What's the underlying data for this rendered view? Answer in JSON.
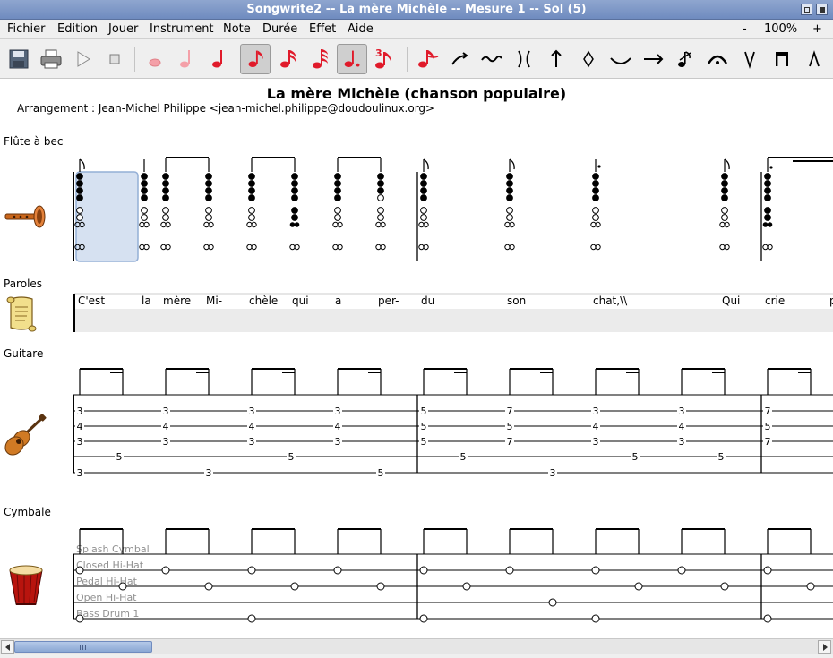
{
  "window": {
    "title": "Songwrite2 -- La mère Michèle -- Mesure 1 -- Sol (5)"
  },
  "menu": [
    "Fichier",
    "Edition",
    "Jouer",
    "Instrument",
    "Note",
    "Durée",
    "Effet",
    "Aide"
  ],
  "zoom": {
    "minus": "-",
    "level": "100%",
    "plus": "+"
  },
  "song": {
    "title": "La mère Michèle (chanson populaire)",
    "arrangement": "Arrangement : Jean-Michel Philippe <jean-michel.philippe@doudoulinux.org>"
  },
  "partitions": {
    "flute": {
      "name": "Flûte à bec",
      "notes": [
        {
          "holes": [
            "f",
            "f",
            "f",
            "f",
            "o",
            "o",
            "o",
            "o"
          ]
        },
        {
          "holes": [
            "f",
            "f",
            "f",
            "f",
            "o",
            "o",
            "o",
            "o"
          ]
        },
        {
          "holes": [
            "f",
            "f",
            "f",
            "f",
            "o",
            "o",
            "o",
            "o"
          ]
        },
        {
          "holes": [
            "f",
            "f",
            "f",
            "f",
            "o",
            "o",
            "o",
            "o"
          ]
        },
        {
          "holes": [
            "f",
            "f",
            "f",
            "f",
            "o",
            "o",
            "o",
            "o"
          ]
        },
        {
          "holes": [
            "f",
            "f",
            "f",
            "f",
            "f",
            "f",
            "h",
            "o"
          ]
        },
        {
          "holes": [
            "f",
            "f",
            "f",
            "f",
            "o",
            "o",
            "o",
            "o"
          ]
        },
        {
          "holes": [
            "f",
            "f",
            "f",
            "o",
            "o",
            "o",
            "o",
            "o"
          ]
        },
        {
          "holes": [
            "f",
            "f",
            "f",
            "f",
            "o",
            "o",
            "o",
            "o"
          ]
        },
        {
          "holes": [
            "f",
            "f",
            "f",
            "f",
            "o",
            "o",
            "o",
            "o"
          ]
        },
        {
          "holes": [
            "f",
            "f",
            "f",
            "f",
            "o",
            "o",
            "o",
            "o"
          ]
        },
        {
          "holes": [
            "f",
            "f",
            "f",
            "f",
            "o",
            "o",
            "o",
            "o"
          ]
        },
        {
          "holes": [
            "f",
            "f",
            "f",
            "f",
            "f",
            "f",
            "h",
            "o"
          ]
        }
      ]
    },
    "lyrics": {
      "name": "Paroles",
      "words": [
        "C'est",
        "la",
        "mère",
        "Mi-",
        "chèle",
        "qui",
        "a",
        "per-",
        "du",
        "son",
        "chat,\\\\",
        "Qui",
        "crie",
        "p"
      ]
    },
    "guitar": {
      "name": "Guitare",
      "eighths": [
        {
          "s": [
            null,
            "3",
            "4",
            "3",
            null,
            "3"
          ]
        },
        {
          "s": [
            null,
            null,
            null,
            null,
            "5",
            null
          ]
        },
        {
          "s": [
            null,
            "3",
            "4",
            "3",
            null,
            null
          ]
        },
        {
          "s": [
            null,
            null,
            null,
            null,
            null,
            "3"
          ]
        },
        {
          "s": [
            null,
            "3",
            "4",
            "3",
            null,
            null
          ]
        },
        {
          "s": [
            null,
            null,
            null,
            null,
            "5",
            null
          ]
        },
        {
          "s": [
            null,
            "3",
            "4",
            "3",
            null,
            null
          ]
        },
        {
          "s": [
            null,
            null,
            null,
            null,
            null,
            "5"
          ]
        },
        {
          "s": [
            null,
            "5",
            "5",
            "5",
            null,
            null
          ]
        },
        {
          "s": [
            null,
            null,
            null,
            null,
            "5",
            null
          ]
        },
        {
          "s": [
            null,
            "7",
            "5",
            "7",
            null,
            null
          ]
        },
        {
          "s": [
            null,
            null,
            null,
            null,
            null,
            "3"
          ]
        },
        {
          "s": [
            null,
            "3",
            "4",
            "3",
            null,
            null
          ]
        },
        {
          "s": [
            null,
            null,
            null,
            null,
            "5",
            null
          ]
        },
        {
          "s": [
            null,
            "3",
            "4",
            "3",
            null,
            null
          ]
        },
        {
          "s": [
            null,
            null,
            null,
            null,
            "5",
            null
          ]
        },
        {
          "s": [
            null,
            "7",
            "5",
            "7",
            null,
            null
          ]
        }
      ]
    },
    "cymbal": {
      "name": "Cymbale",
      "instruments": [
        "Splash Cymbal",
        "Closed Hi-Hat",
        "Pedal Hi-Hat",
        "Open Hi-Hat",
        "Bass Drum 1"
      ],
      "eighths": [
        {
          "hits": [
            1,
            4
          ]
        },
        {
          "hits": [
            2
          ]
        },
        {
          "hits": [
            1
          ]
        },
        {
          "hits": [
            2
          ]
        },
        {
          "hits": [
            1,
            4
          ]
        },
        {
          "hits": [
            2
          ]
        },
        {
          "hits": [
            1
          ]
        },
        {
          "hits": [
            2
          ]
        },
        {
          "hits": [
            1,
            4
          ]
        },
        {
          "hits": [
            2
          ]
        },
        {
          "hits": [
            1
          ]
        },
        {
          "hits": [
            3
          ]
        },
        {
          "hits": [
            1,
            4
          ]
        },
        {
          "hits": [
            2
          ]
        },
        {
          "hits": [
            1
          ]
        },
        {
          "hits": [
            2
          ]
        },
        {
          "hits": [
            1,
            4
          ]
        },
        {
          "hits": [
            2
          ]
        }
      ]
    }
  }
}
